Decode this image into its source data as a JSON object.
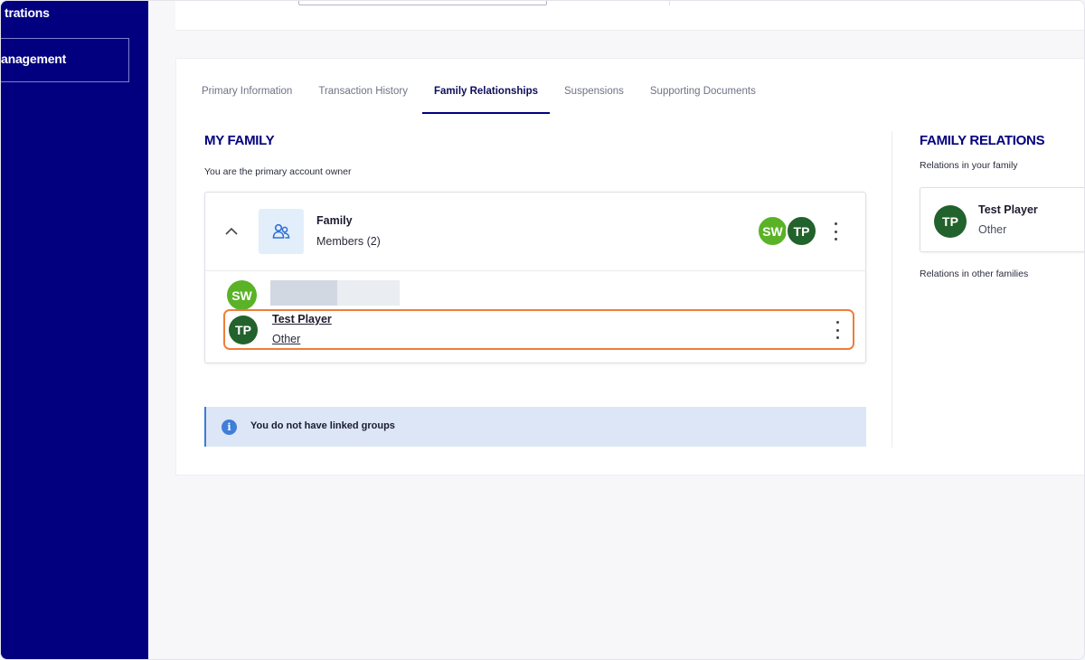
{
  "sidebar": {
    "items": [
      {
        "label": "trations"
      },
      {
        "label": "anagement"
      }
    ]
  },
  "tabs": [
    {
      "label": "Primary Information"
    },
    {
      "label": "Transaction History"
    },
    {
      "label": "Family Relationships",
      "active": true
    },
    {
      "label": "Suspensions"
    },
    {
      "label": "Supporting Documents"
    }
  ],
  "my_family": {
    "title": "MY FAMILY",
    "subtitle": "You are the primary account owner",
    "group": {
      "name": "Family",
      "members_label": "Members (2)",
      "avatars": [
        "SW",
        "TP"
      ]
    },
    "members": [
      {
        "initials": "SW"
      },
      {
        "initials": "TP",
        "name": "Test Player",
        "relation": "Other"
      }
    ]
  },
  "info": {
    "icon": "i",
    "message": "You do not have linked groups"
  },
  "family_relations": {
    "title": "FAMILY RELATIONS",
    "in_family_label": "Relations in your family",
    "relation": {
      "initials": "TP",
      "name": "Test Player",
      "type": "Other"
    },
    "other_families_label": "Relations in other families"
  },
  "colors": {
    "sidebar": "#02007f",
    "accent": "#02007f",
    "avatar_sw": "#5ab227",
    "avatar_tp": "#22622c",
    "highlight": "#ef7d3a",
    "info_bg": "#dce6f6"
  }
}
